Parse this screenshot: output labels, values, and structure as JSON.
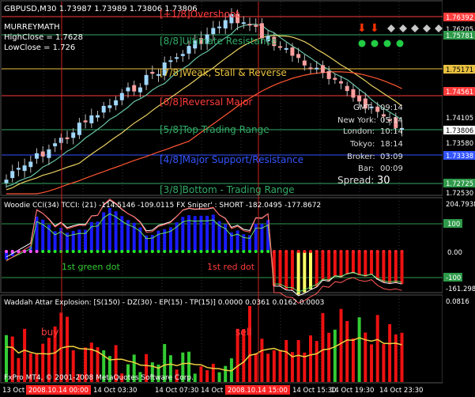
{
  "main": {
    "symbol_line": "GBPUSD,M30  1.73987 1.73989 1.73806 1.73806",
    "indicator": "MURREYMATH",
    "high_close": "HighClose = 1.7628",
    "low_close": "LowClose = 1.726",
    "levels": [
      {
        "label": "[+1/8]Overshoot",
        "color": "#ff3b3b"
      },
      {
        "label": "[8/8]Ultimate Resistance",
        "color": "#33aa66"
      },
      {
        "label": "[7/8]Weak, Stall & Reverse",
        "color": "#e8c040"
      },
      {
        "label": "[6/8]Reversal Major",
        "color": "#ff3b3b"
      },
      {
        "label": "[5/8]Top Trading Range",
        "color": "#33aa66"
      },
      {
        "label": "[4/8]Major Support/Resistance",
        "color": "#3355ff"
      },
      {
        "label": "[3/8]Bottom - Trading Range",
        "color": "#33aa66"
      }
    ],
    "price_axis": [
      {
        "text": "1.76392",
        "bg": "#ff3b3b"
      },
      {
        "text": "1.76205",
        "bg": ""
      },
      {
        "text": "1.75781",
        "bg": "#2e9a4a"
      },
      {
        "text": "1.75171",
        "bg": "#e8c040"
      },
      {
        "text": "1.74561",
        "bg": "#ff3b3b"
      },
      {
        "text": "1.74105",
        "bg": ""
      },
      {
        "text": "1.73806",
        "bg": "#ffffff"
      },
      {
        "text": "1.73580",
        "bg": ""
      },
      {
        "text": "1.73338",
        "bg": "#3355ff"
      },
      {
        "text": "1.72725",
        "bg": "#2e9a4a"
      },
      {
        "text": "1.72530",
        "bg": ""
      }
    ],
    "info": {
      "gmt_label": "GMT:",
      "gmt": "09:14",
      "ny_label": "New York:",
      "ny": "05:14",
      "london_label": "London:",
      "london": "10:14",
      "tokyo_label": "Tokyo:",
      "tokyo": "18:14",
      "broker_label": "Broker:",
      "broker": "03:09",
      "bar_label": "Bar:",
      "bar": "00:09",
      "spread_label": "Spread:",
      "spread": "30"
    },
    "signal_colors": {
      "down": "#ff3300",
      "grey": "#c8c8c8",
      "green": "#22cc44"
    }
  },
  "cci": {
    "title": "Woodie CCI(34)  TCCI: (21) -114.5146  -109.0115  FX Sniper' : SHORT -182.0495  -177.8672",
    "axis": [
      "204.7938",
      "100",
      "0.00",
      "-100",
      "-161.2980"
    ],
    "label_green": "1st green dot",
    "label_red": "1st red dot"
  },
  "waddah": {
    "title": "Waddah Attar Explosion: [S(150) - DZ(30) - EP(15) - TP(15)] 0.0000 0.0361 0.0162 0.0003",
    "axis_top": "0.0816",
    "label_buy": "buy",
    "label_sell": "sell",
    "copyright": "FxPro MT4, © 2001-2008 MetaQuotes Software Corp."
  },
  "time_axis": {
    "items": [
      {
        "text": "13 Oct 2008",
        "highlight": false
      },
      {
        "text": "2008.10.14 00:00",
        "highlight": true
      },
      {
        "text": "14 Oct 03:30",
        "highlight": false
      },
      {
        "text": "14 Oct 07:30",
        "highlight": false
      },
      {
        "text": "14 Oct 11:30",
        "highlight": false
      },
      {
        "text": "2008.10.14 15:00",
        "highlight": true
      },
      {
        "text": "14 Oct 15:30",
        "highlight": false
      },
      {
        "text": "14 Oct 19:30",
        "highlight": false
      },
      {
        "text": "14 Oct 23:30",
        "highlight": false
      }
    ]
  }
}
